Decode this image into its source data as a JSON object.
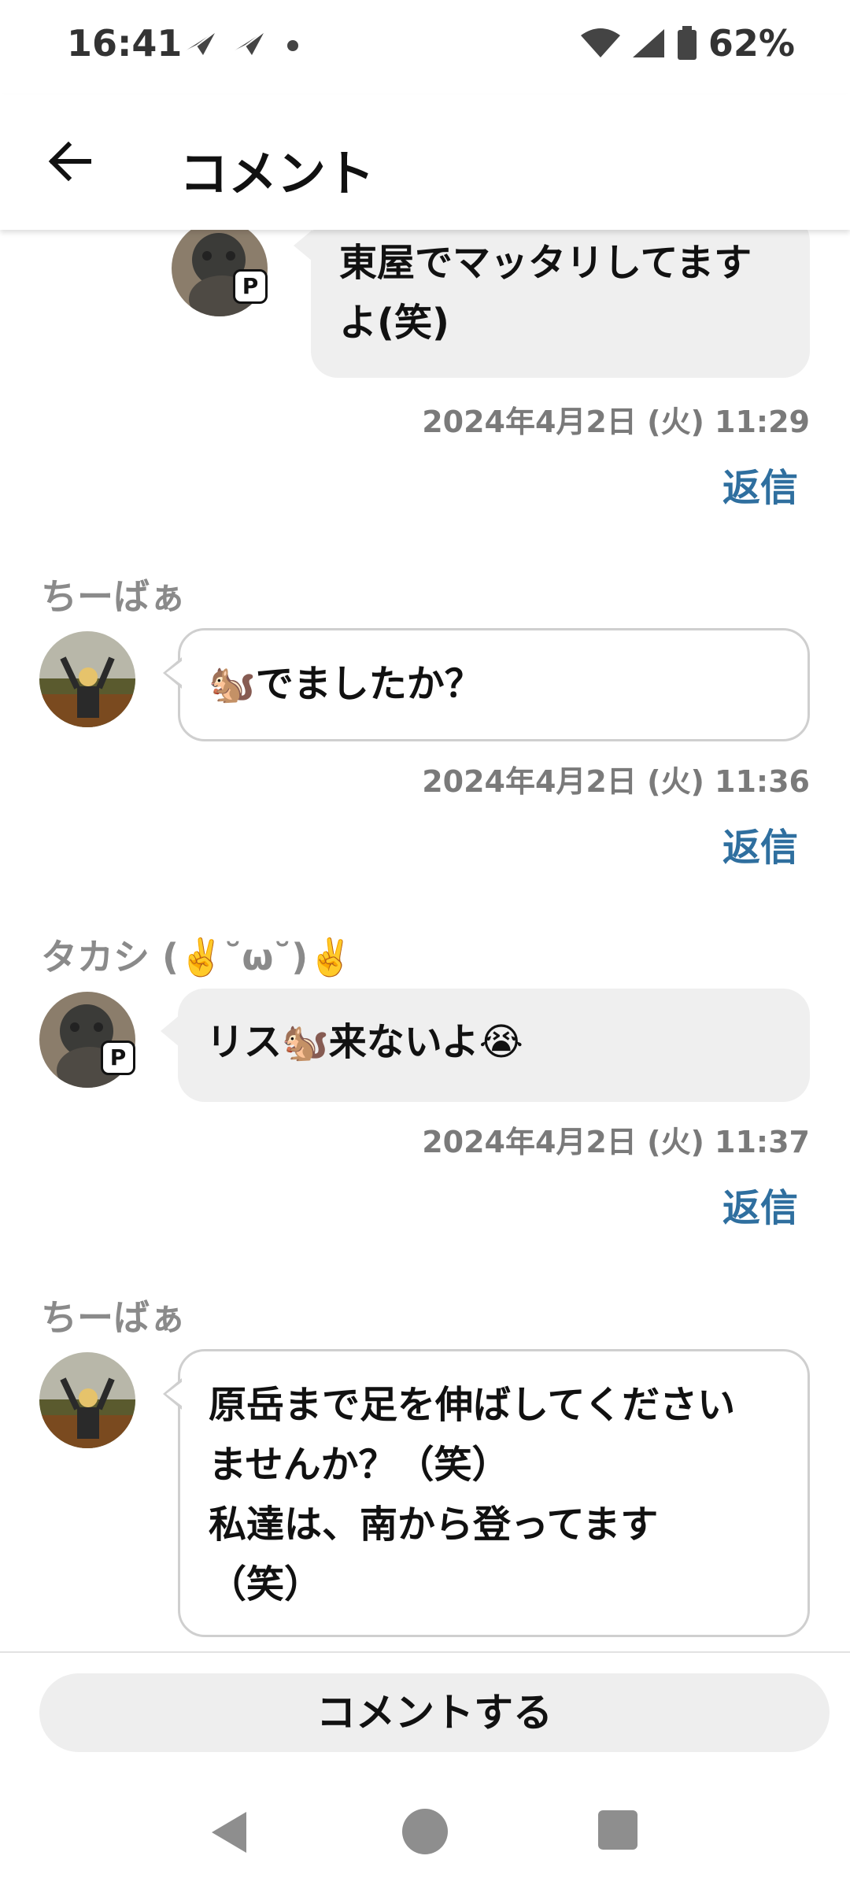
{
  "status_bar": {
    "time": "16:41",
    "battery": "62%"
  },
  "header": {
    "title": "コメント"
  },
  "comments": [
    {
      "author": "",
      "text_lines": [
        "東屋でマッタリしてます",
        "よ(笑)"
      ],
      "timestamp": "2024年4月2日 (火) 11:29",
      "reply": "返信",
      "bubble": "gray"
    },
    {
      "author": "ちーばぁ",
      "text_lines": [
        "🐿️でましたか？"
      ],
      "timestamp": "2024年4月2日 (火) 11:36",
      "reply": "返信",
      "bubble": "white"
    },
    {
      "author": "タカシ (✌️˘ω˘)✌️",
      "text_lines": [
        "リス🐿️来ないよ😭"
      ],
      "timestamp": "2024年4月2日 (火) 11:37",
      "reply": "返信",
      "bubble": "gray"
    },
    {
      "author": "ちーばぁ",
      "text_lines": [
        "原岳まで足を伸ばしてください",
        "ませんか？（笑）",
        "私達は、南から登ってます",
        "（笑）"
      ],
      "timestamp": "",
      "reply": "",
      "bubble": "white"
    }
  ],
  "badge": {
    "label": "P"
  },
  "footer": {
    "comment_button": "コメントする"
  },
  "colors": {
    "reply_link": "#2f6f9f",
    "author": "#8a8a8a",
    "timestamp": "#7a7a7a",
    "bubble_gray": "#efefef"
  },
  "icons": {
    "back": "arrow-left-icon",
    "wifi": "wifi-icon",
    "signal": "signal-icon",
    "battery": "battery-icon"
  }
}
